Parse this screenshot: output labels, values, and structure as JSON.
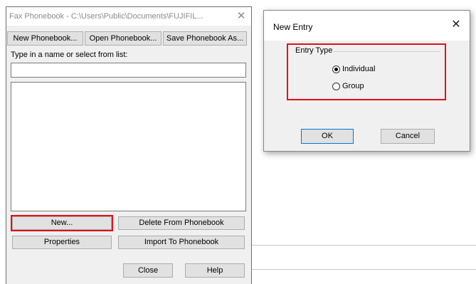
{
  "phonebook": {
    "title": "Fax Phonebook - C:\\Users\\Public\\Documents\\FUJIFIL...",
    "close_glyph": "✕",
    "toolbar": {
      "new_phonebook": "New Phonebook...",
      "open_phonebook": "Open Phonebook...",
      "save_phonebook_as": "Save Phonebook As..."
    },
    "search_label": "Type in a name or select from list:",
    "search_value": "",
    "buttons": {
      "new": "New...",
      "delete_from_phonebook": "Delete From Phonebook",
      "properties": "Properties",
      "import_to_phonebook": "Import To Phonebook",
      "close": "Close",
      "help": "Help"
    }
  },
  "new_entry": {
    "title": "New Entry",
    "close_glyph": "✕",
    "group_label": "Entry Type",
    "options": [
      {
        "label": "Individual",
        "selected": true
      },
      {
        "label": "Group",
        "selected": false
      }
    ],
    "ok_label": "OK",
    "cancel_label": "Cancel"
  },
  "colors": {
    "highlight": "#e0101f",
    "dialog_bg": "#f0f0f0",
    "button_bg": "#e1e1e1",
    "ok_border": "#0078d7"
  }
}
